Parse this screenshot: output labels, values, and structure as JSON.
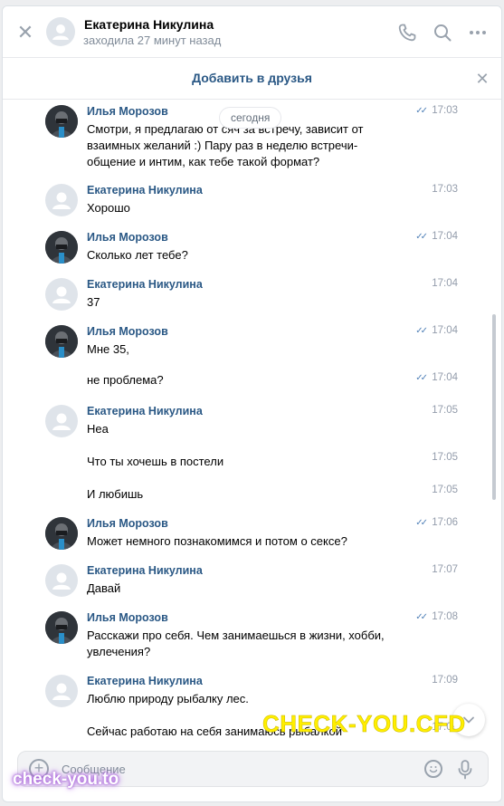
{
  "header": {
    "name": "Екатерина Никулина",
    "status": "заходила 27 минут назад"
  },
  "friend_bar": {
    "add_label": "Добавить в друзья"
  },
  "date_separator": "сегодня",
  "messages": [
    {
      "author": "Илья Морозов",
      "avatar": "ilya",
      "time": "17:03",
      "read": true,
      "text": "Смотри, я предлагаю от          сяч за встречу, зависит от взаимных желаний :) Пару раз в неделю встречи-общение и интим, как тебе такой формат?"
    },
    {
      "author": "Екатерина Никулина",
      "avatar": "kat",
      "time": "17:03",
      "read": false,
      "text": "Хорошо"
    },
    {
      "author": "Илья Морозов",
      "avatar": "ilya",
      "time": "17:04",
      "read": true,
      "text": "Сколько лет тебе?"
    },
    {
      "author": "Екатерина Никулина",
      "avatar": "kat",
      "time": "17:04",
      "read": false,
      "text": "37"
    },
    {
      "author": "Илья Морозов",
      "avatar": "ilya",
      "time": "17:04",
      "read": true,
      "text": "Мне 35,"
    },
    {
      "author": "",
      "avatar": "",
      "time": "17:04",
      "read": true,
      "text": "не проблема?"
    },
    {
      "author": "Екатерина Никулина",
      "avatar": "kat",
      "time": "17:05",
      "read": false,
      "text": "Неа"
    },
    {
      "author": "",
      "avatar": "",
      "time": "17:05",
      "read": false,
      "text": "Что ты хочешь в постели"
    },
    {
      "author": "",
      "avatar": "",
      "time": "17:05",
      "read": false,
      "text": "И любишь"
    },
    {
      "author": "Илья Морозов",
      "avatar": "ilya",
      "time": "17:06",
      "read": true,
      "text": "Может немного познакомимся и потом о сексе?"
    },
    {
      "author": "Екатерина Никулина",
      "avatar": "kat",
      "time": "17:07",
      "read": false,
      "text": "Давай"
    },
    {
      "author": "Илья Морозов",
      "avatar": "ilya",
      "time": "17:08",
      "read": true,
      "text": "Расскажи про себя. Чем занимаешься в жизни, хобби, увлечения?"
    },
    {
      "author": "Екатерина Никулина",
      "avatar": "kat",
      "time": "17:09",
      "read": false,
      "text": "Люблю природу рыбалку лес."
    },
    {
      "author": "",
      "avatar": "",
      "time": "17:09",
      "read": false,
      "text": "Сейчас работаю на себя занимаюсь рыбалкой"
    }
  ],
  "composer": {
    "placeholder": "Сообщение"
  },
  "watermarks": {
    "main": "CHECK-YOU.CFD",
    "corner": "check-you.to"
  },
  "colors": {
    "link": "#2a5885",
    "accent": "#5181b8",
    "muted": "#818c99",
    "watermark_main": "#ffee00"
  }
}
